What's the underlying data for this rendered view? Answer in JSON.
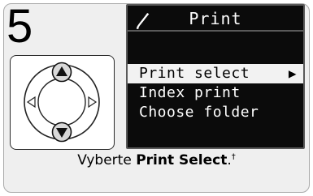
{
  "step": {
    "number": "5"
  },
  "multi_selector": {
    "highlighted": [
      "up",
      "down"
    ],
    "icons": [
      "up-arrow",
      "down-arrow",
      "left-arrow",
      "right-arrow"
    ]
  },
  "lcd": {
    "title_icon": "print-icon",
    "title": "Print",
    "items": [
      {
        "label": "Print select",
        "selected": true,
        "arrow": "▶"
      },
      {
        "label": "Index print",
        "selected": false
      },
      {
        "label": "Choose folder",
        "selected": false
      }
    ]
  },
  "caption": {
    "prefix": "Vyberte ",
    "bold": "Print Select",
    "suffix": ".",
    "footnote": "†"
  },
  "colors": {
    "background": "#efefef",
    "lcd_background": "#0b0b0b",
    "selected_row": "#f2f2f2"
  }
}
